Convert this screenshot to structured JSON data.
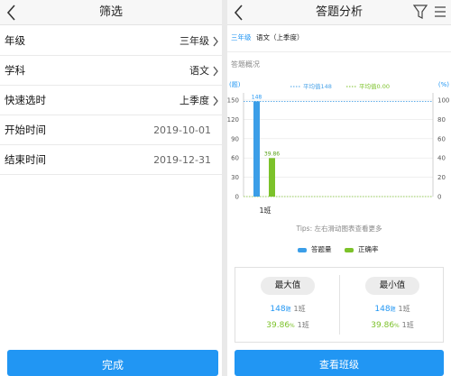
{
  "filter_panel": {
    "title": "筛选",
    "rows": [
      {
        "label": "年级",
        "value": "三年级"
      },
      {
        "label": "学科",
        "value": "语文"
      },
      {
        "label": "快速选时",
        "value": "上季度"
      },
      {
        "label": "开始时间",
        "value": "2019-10-01"
      },
      {
        "label": "结束时间",
        "value": "2019-12-31"
      }
    ],
    "done_label": "完成"
  },
  "analysis_panel": {
    "title": "答题分析",
    "tag_grade": "三年级",
    "tag_subject": "语文（上季度）",
    "section_title": "答题概况",
    "tips": "Tips: 左右滑动图表查看更多",
    "legend": [
      "答题量",
      "正确率"
    ],
    "stats": {
      "max_label": "最大值",
      "min_label": "最小值",
      "max_count": "148",
      "max_count_unit": "题",
      "max_count_class": "1班",
      "max_rate": "39.86",
      "max_rate_unit": "%",
      "max_rate_class": "1班",
      "min_count": "148",
      "min_count_unit": "题",
      "min_count_class": "1班",
      "min_rate": "39.86",
      "min_rate_unit": "%",
      "min_rate_class": "1班"
    },
    "view_button": "查看班级"
  },
  "colors": {
    "accent": "#2196f3",
    "green": "#7cc22a",
    "dotted_blue": "#4aa3e8"
  },
  "chart_data": {
    "type": "bar",
    "categories": [
      "1班"
    ],
    "series": [
      {
        "name": "答题量",
        "values": [
          148
        ],
        "axis": "left",
        "color": "#3b9ee8"
      },
      {
        "name": "正确率",
        "values": [
          39.86
        ],
        "axis": "right",
        "color": "#7cc22a"
      }
    ],
    "ylabel": "(题)",
    "y2label": "(%)",
    "ylim": [
      0,
      150
    ],
    "y2lim": [
      0,
      100
    ],
    "yticks": [
      0,
      30,
      60,
      90,
      120,
      150
    ],
    "y2ticks": [
      0,
      20,
      40,
      60,
      80,
      100
    ],
    "data_labels": [
      "148",
      "39.86"
    ],
    "reference_lines": [
      {
        "label": "平均值148",
        "value": 148,
        "axis": "left"
      },
      {
        "label": "平均值0.00",
        "value": 0,
        "axis": "right"
      }
    ],
    "grid": true
  }
}
